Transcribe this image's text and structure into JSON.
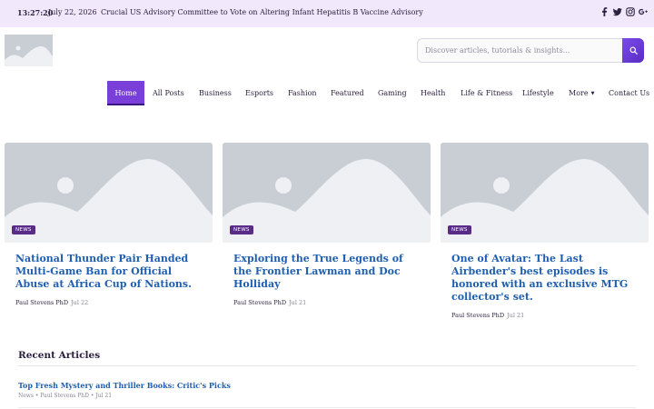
{
  "topbar": {
    "time": "13:27:20",
    "date": "July 22, 2026",
    "ticker": "Crucial US Advisory Committee to Vote on Altering Infant Hepatitis B Vaccine Advisory",
    "social_icons": [
      "facebook-icon",
      "twitter-icon",
      "instagram-icon",
      "google-plus-icon"
    ]
  },
  "search": {
    "placeholder": "Discover articles, tutorials & insights...",
    "value": "",
    "button_icon": "search-icon"
  },
  "nav": {
    "items": [
      {
        "label": "Home",
        "active": true
      },
      {
        "label": "All Posts"
      },
      {
        "label": "Business"
      },
      {
        "label": "Esports"
      },
      {
        "label": "Fashion"
      },
      {
        "label": "Featured"
      },
      {
        "label": "Gaming"
      },
      {
        "label": "Health"
      },
      {
        "label": "Life & Fitness"
      },
      {
        "label": "Lifestyle"
      },
      {
        "label": "More",
        "has_dropdown": true
      },
      {
        "label": "Contact Us"
      }
    ]
  },
  "cards": [
    {
      "badge": "NEWS",
      "title": "National Thunder Pair Handed Multi-Game Ban for Official Abuse at Africa Cup of Nations.",
      "author": "Paul Stevens PhD",
      "date": "Jul 22"
    },
    {
      "badge": "NEWS",
      "title": "Exploring the True Legends of the Frontier Lawman and Doc Holliday",
      "author": "Paul Stevens PhD",
      "date": "Jul 21"
    },
    {
      "badge": "NEWS",
      "title": "One of Avatar: The Last Airbender's best episodes is honored with an exclusive MTG collector's set.",
      "author": "Paul Stevens PhD",
      "date": "Jul 21"
    }
  ],
  "recent": {
    "heading": "Recent Articles",
    "items": [
      {
        "title": "Top Fresh Mystery and Thriller Books: Critic's Picks",
        "meta": "News • Paul Stevens PhD • Jul 21"
      }
    ]
  },
  "colors": {
    "topbar_bg": "#f1e8fb",
    "accent": "#7a3fd9",
    "link": "#1f5fb0",
    "badge": "#5b2b8a"
  }
}
